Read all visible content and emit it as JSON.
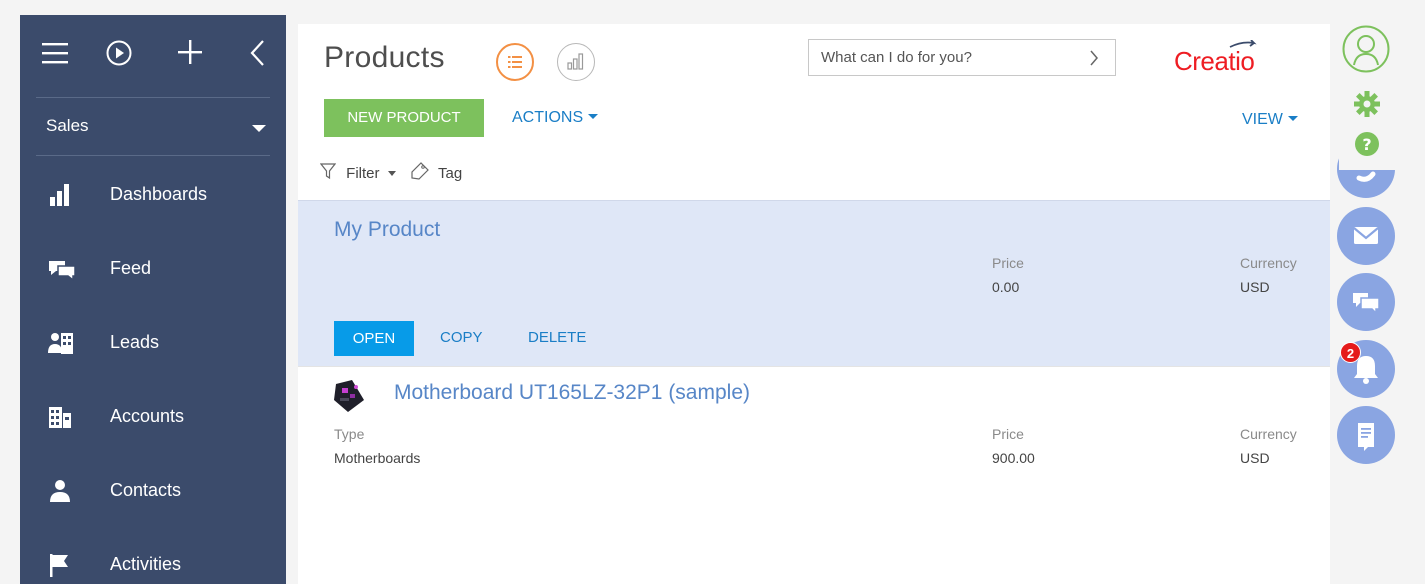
{
  "sidebar": {
    "workplace": "Sales",
    "items": [
      {
        "label": "Dashboards",
        "icon": "dashboards-icon"
      },
      {
        "label": "Feed",
        "icon": "feed-icon"
      },
      {
        "label": "Leads",
        "icon": "leads-icon"
      },
      {
        "label": "Accounts",
        "icon": "accounts-icon"
      },
      {
        "label": "Contacts",
        "icon": "contacts-icon"
      },
      {
        "label": "Activities",
        "icon": "activities-icon"
      }
    ]
  },
  "header": {
    "title": "Products",
    "search_placeholder": "What can I do for you?",
    "logo": "Creatio"
  },
  "toolbar": {
    "new_label": "NEW PRODUCT",
    "actions_label": "ACTIONS",
    "view_label": "VIEW",
    "filter_label": "Filter",
    "tag_label": "Tag"
  },
  "records": [
    {
      "name": "My Product",
      "price_label": "Price",
      "price": "0.00",
      "currency_label": "Currency",
      "currency": "USD",
      "actions": {
        "open": "OPEN",
        "copy": "COPY",
        "delete": "DELETE"
      }
    },
    {
      "name": "Motherboard UT165LZ-32P1 (sample)",
      "type_label": "Type",
      "type": "Motherboards",
      "price_label": "Price",
      "price": "900.00",
      "currency_label": "Currency",
      "currency": "USD"
    }
  ],
  "right_panel": {
    "notifications_count": "2"
  },
  "colors": {
    "sidebar": "#3b4b6b",
    "accent_green": "#7dc15d",
    "link_blue": "#1a7ec6",
    "selected_row": "#dfe7f7",
    "brand_red": "#ee1d23",
    "orange": "#f39044"
  }
}
